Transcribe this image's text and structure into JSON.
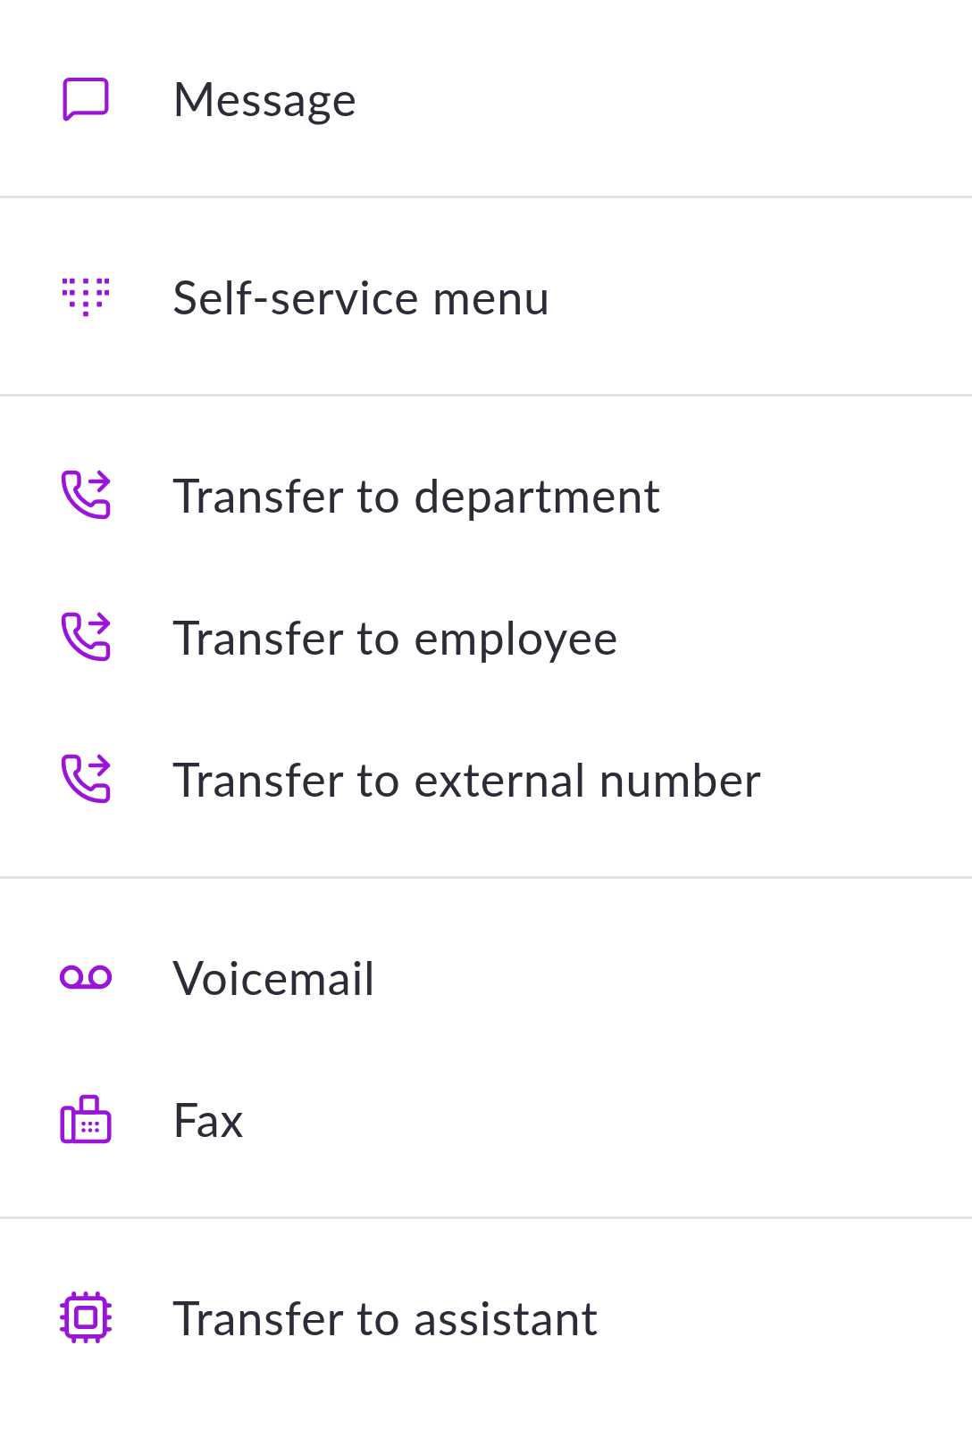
{
  "groups": [
    {
      "items": [
        {
          "kind": "message",
          "label": "Message"
        }
      ]
    },
    {
      "items": [
        {
          "kind": "dialpad",
          "label": "Self-service menu"
        }
      ]
    },
    {
      "items": [
        {
          "kind": "transfer",
          "label": "Transfer to department"
        },
        {
          "kind": "transfer",
          "label": "Transfer to employee"
        },
        {
          "kind": "transfer",
          "label": "Transfer to external number"
        }
      ]
    },
    {
      "items": [
        {
          "kind": "voicemail",
          "label": "Voicemail"
        },
        {
          "kind": "fax",
          "label": "Fax"
        }
      ]
    },
    {
      "items": [
        {
          "kind": "assistant",
          "label": "Transfer to assistant"
        }
      ]
    }
  ]
}
